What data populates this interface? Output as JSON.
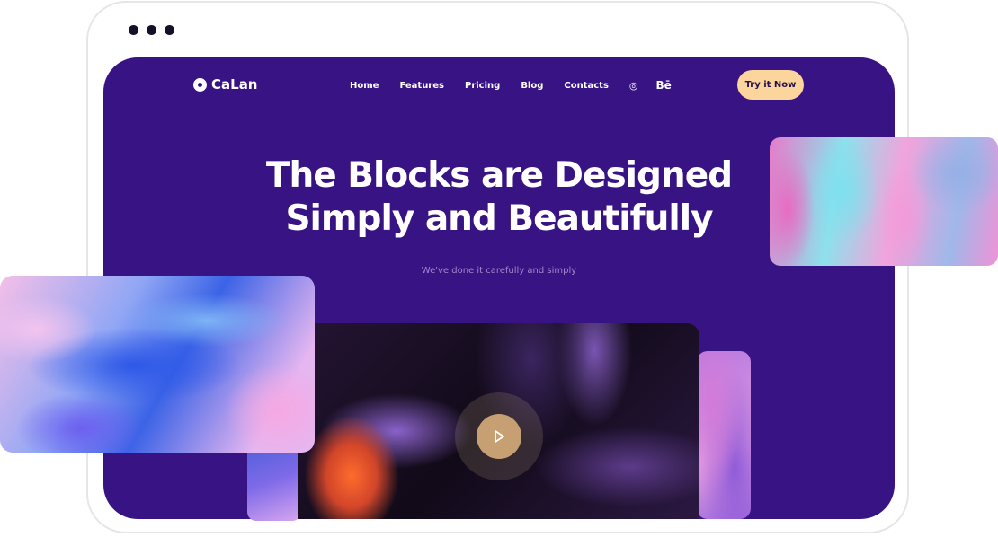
{
  "brand": {
    "name": "CaLan"
  },
  "nav": {
    "items": [
      "Home",
      "Features",
      "Pricing",
      "Blog",
      "Contacts"
    ],
    "social": [
      {
        "icon": "dribbble-icon",
        "glyph": "◎"
      },
      {
        "icon": "behance-icon",
        "glyph": "Bē"
      }
    ]
  },
  "cta": {
    "label": "Try it Now"
  },
  "hero": {
    "title_line1": "The Blocks are Designed",
    "title_line2": "Simply and Beautifully",
    "subtitle": "We've done it carefully and simply"
  },
  "colors": {
    "screen_bg": "#381383",
    "cta_bg": "#fbd59b",
    "play_button": "#c69f72"
  }
}
